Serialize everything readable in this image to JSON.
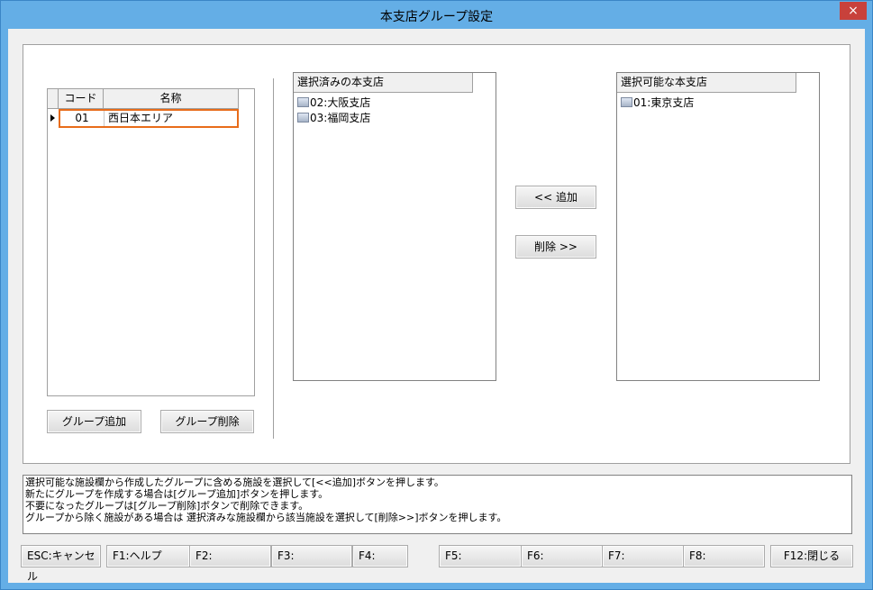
{
  "window": {
    "title": "本支店グループ設定",
    "close": "×"
  },
  "group_grid": {
    "headers": {
      "code": "コード",
      "name": "名称"
    },
    "rows": [
      {
        "code": "01",
        "name": "西日本エリア"
      }
    ]
  },
  "buttons": {
    "group_add": "グループ追加",
    "group_delete": "グループ削除",
    "add": "<< 追加",
    "remove": "削除 >>"
  },
  "selected_list": {
    "header": "選択済みの本支店",
    "items": [
      "02:大阪支店",
      "03:福岡支店"
    ]
  },
  "available_list": {
    "header": "選択可能な本支店",
    "items": [
      "01:東京支店"
    ]
  },
  "messages": [
    "選択可能な施設欄から作成したグループに含める施設を選択して[<<追加]ボタンを押します。",
    "新たにグループを作成する場合は[グループ追加]ボタンを押します。",
    "不要になったグループは[グループ削除]ボタンで削除できます。",
    "グループから除く施設がある場合は 選択済みな施設欄から該当施設を選択して[削除>>]ボタンを押します。"
  ],
  "function_keys": {
    "esc": "ESC:キャンセル",
    "f1": "F1:ヘルプ",
    "f2": "F2:",
    "f3": "F3:",
    "f4": "F4:",
    "f5": "F5:",
    "f6": "F6:",
    "f7": "F7:",
    "f8": "F8:",
    "f12": "F12:閉じる"
  },
  "colors": {
    "titlebar": "#64aee6",
    "close": "#c8413b",
    "selection_border": "#e86c1a"
  }
}
